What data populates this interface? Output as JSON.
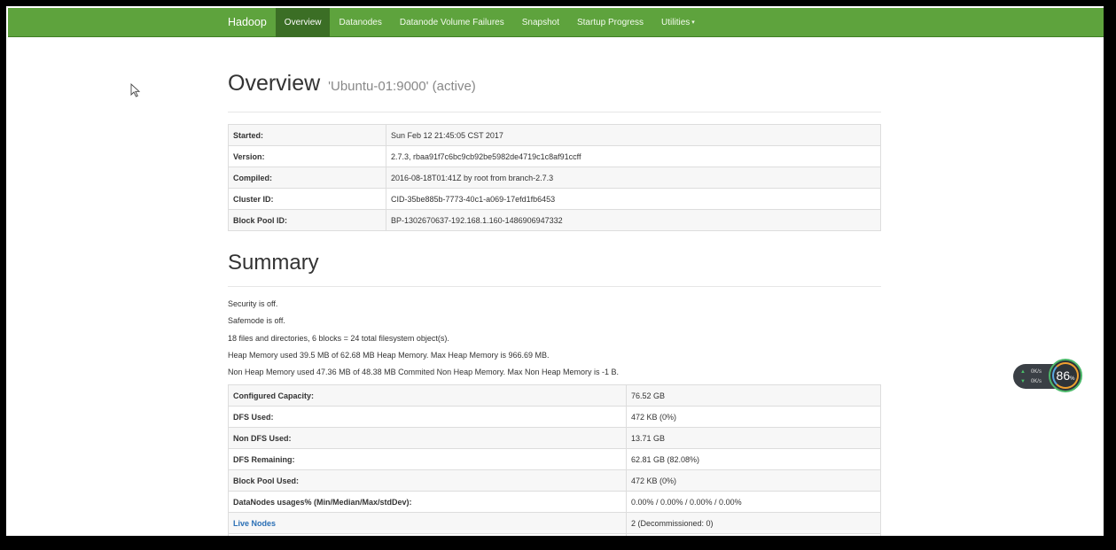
{
  "navbar": {
    "brand": "Hadoop",
    "items": [
      {
        "label": "Overview"
      },
      {
        "label": "Datanodes"
      },
      {
        "label": "Datanode Volume Failures"
      },
      {
        "label": "Snapshot"
      },
      {
        "label": "Startup Progress"
      },
      {
        "label": "Utilities",
        "caret": "▾"
      }
    ]
  },
  "overview": {
    "title": "Overview",
    "subtitle": "'Ubuntu-01:9000' (active)",
    "rows": [
      {
        "key": "Started:",
        "value": "Sun Feb 12 21:45:05 CST 2017"
      },
      {
        "key": "Version:",
        "value": "2.7.3, rbaa91f7c6bc9cb92be5982de4719c1c8af91ccff"
      },
      {
        "key": "Compiled:",
        "value": "2016-08-18T01:41Z by root from branch-2.7.3"
      },
      {
        "key": "Cluster ID:",
        "value": "CID-35be885b-7773-40c1-a069-17efd1fb6453"
      },
      {
        "key": "Block Pool ID:",
        "value": "BP-1302670637-192.168.1.160-1486906947332"
      }
    ]
  },
  "summary": {
    "title": "Summary",
    "lines": [
      "Security is off.",
      "Safemode is off.",
      "18 files and directories, 6 blocks = 24 total filesystem object(s).",
      "Heap Memory used 39.5 MB of 62.68 MB Heap Memory. Max Heap Memory is 966.69 MB.",
      "Non Heap Memory used 47.36 MB of 48.38 MB Commited Non Heap Memory. Max Non Heap Memory is -1 B."
    ],
    "rows": [
      {
        "key": "Configured Capacity:",
        "value": "76.52 GB"
      },
      {
        "key": "DFS Used:",
        "value": "472 KB (0%)"
      },
      {
        "key": "Non DFS Used:",
        "value": "13.71 GB"
      },
      {
        "key": "DFS Remaining:",
        "value": "62.81 GB (82.08%)"
      },
      {
        "key": "Block Pool Used:",
        "value": "472 KB (0%)"
      },
      {
        "key": "DataNodes usages% (Min/Median/Max/stdDev):",
        "value": "0.00% / 0.00% / 0.00% / 0.00%"
      },
      {
        "key": "Live Nodes",
        "value": "2 (Decommissioned: 0)"
      }
    ]
  },
  "net_widget": {
    "up": "0K/s",
    "down": "0K/s",
    "percent": "86",
    "percent_sign": "%"
  },
  "colors": {
    "navbar": "#5ea33d",
    "nav_active": "#3b6e25",
    "link": "#2a6fb5"
  }
}
